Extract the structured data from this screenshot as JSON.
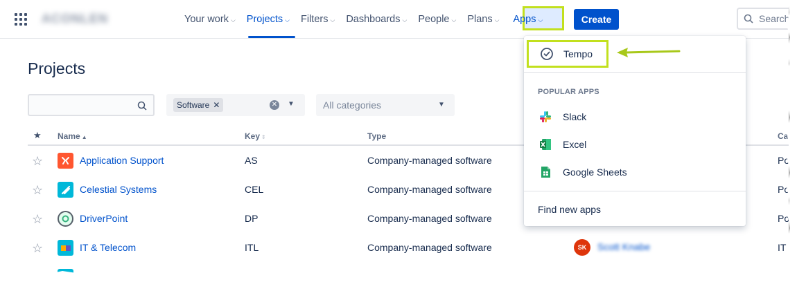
{
  "nav": {
    "logo_text": "ACONLEN",
    "items": [
      {
        "label": "Your work"
      },
      {
        "label": "Projects"
      },
      {
        "label": "Filters"
      },
      {
        "label": "Dashboards"
      },
      {
        "label": "People"
      },
      {
        "label": "Plans"
      },
      {
        "label": "Apps"
      }
    ],
    "create_label": "Create",
    "search_placeholder": "Search"
  },
  "page": {
    "title": "Projects",
    "filters": {
      "search_value": "",
      "type_chip": "Software",
      "category_placeholder": "All categories"
    },
    "table": {
      "headers": {
        "name": "Name",
        "key": "Key",
        "type": "Type",
        "category": "Ca"
      },
      "rows": [
        {
          "name": "Application Support",
          "key": "AS",
          "type": "Company-managed software",
          "category": "Po"
        },
        {
          "name": "Celestial Systems",
          "key": "CEL",
          "type": "Company-managed software",
          "category": "Po"
        },
        {
          "name": "DriverPoint",
          "key": "DP",
          "type": "Company-managed software",
          "category": "Po"
        },
        {
          "name": "IT & Telecom",
          "key": "ITL",
          "type": "Company-managed software",
          "category": "IT",
          "lead_initials": "SK",
          "lead_name": "Scott Knabe"
        }
      ]
    }
  },
  "apps_dropdown": {
    "tempo_label": "Tempo",
    "popular_heading": "POPULAR APPS",
    "popular": [
      {
        "label": "Slack",
        "icon": "slack-icon"
      },
      {
        "label": "Excel",
        "icon": "excel-icon"
      },
      {
        "label": "Google Sheets",
        "icon": "google-sheets-icon"
      }
    ],
    "find_label": "Find new apps"
  },
  "colors": {
    "brand_blue": "#0052cc",
    "highlight_green": "#c2e01e",
    "text": "#172b4d"
  }
}
